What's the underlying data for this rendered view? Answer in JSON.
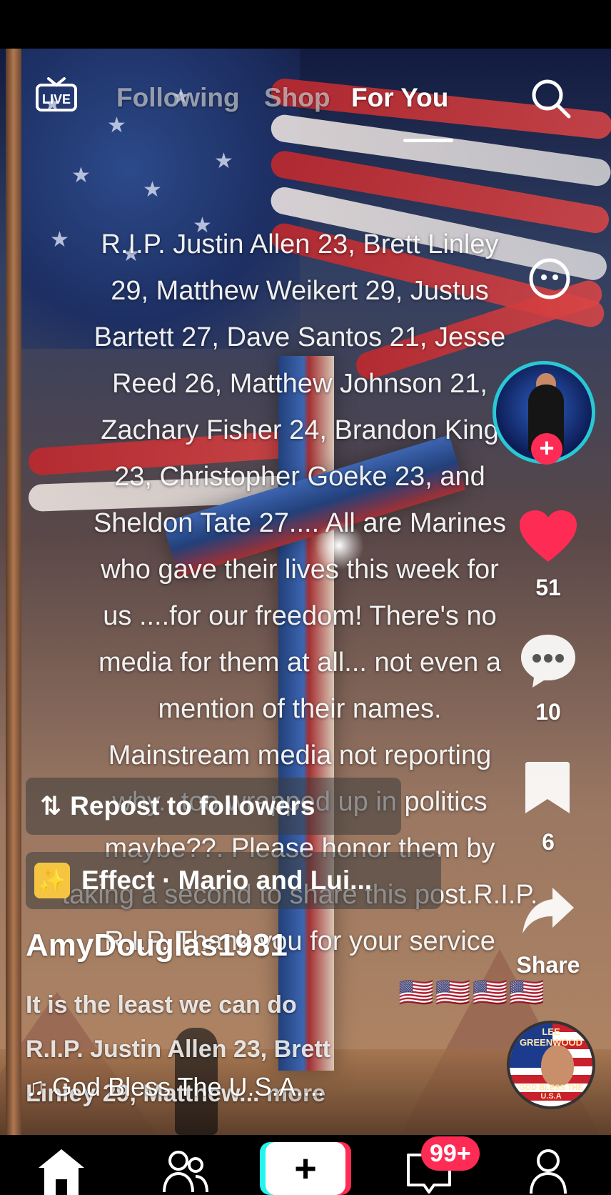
{
  "top_nav": {
    "live_label": "LIVE",
    "tabs": [
      {
        "label": "Following"
      },
      {
        "label": "Shop"
      },
      {
        "label": "For You"
      }
    ]
  },
  "caption_lines": [
    "R.I.P. Justin Allen 23, Brett Linley",
    "29, Matthew Weikert 29, Justus",
    "Bartett 27, Dave Santos 21, Jesse",
    "Reed 26, Matthew Johnson 21,",
    "Zachary Fisher 24, Brandon King",
    "23, Christopher Goeke 23, and",
    "Sheldon Tate 27.... All are Marines",
    "who gave their lives this week for",
    "us ....for our freedom! There's no",
    "media for them at all... not even a",
    "mention of their names.",
    "Mainstream media not reporting",
    "why...too wrapped up in politics",
    "maybe??. Please honor them by",
    "taking a second to share this post.R.I.P.",
    "R.I.P. Thank you for your service"
  ],
  "rail": {
    "likes": "51",
    "comments": "10",
    "saves": "6",
    "share_label": "Share",
    "like_color": "#fe2c55"
  },
  "chips": {
    "repost": "Repost to followers",
    "effect": "Effect · Mario and Lui..."
  },
  "post": {
    "username": "AmyDouglas1981",
    "description_line1": "It is the least we can do",
    "description_line2": "R.I.P. Justin Allen 23, Brett",
    "description_line3": "Linley 29, Matthew...",
    "more": " more",
    "flags": "🇺🇸🇺🇸🇺🇸🇺🇸",
    "sound": "God Bless The U.S.A...."
  },
  "sound_disc": {
    "top_text": "LEE GREENWOOD",
    "bottom_text": "GOD BLESS THE U.S.A"
  },
  "bottom_bar": {
    "inbox_badge": "99+"
  }
}
